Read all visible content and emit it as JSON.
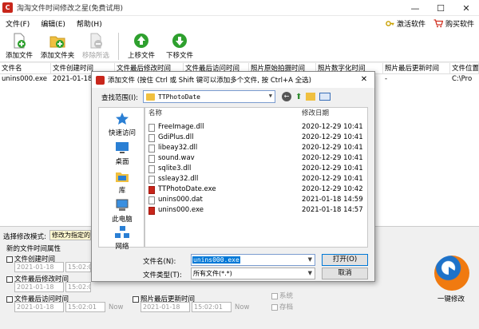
{
  "window": {
    "title": "淘淘文件时间修改之星(免费试用)",
    "minimize": "—",
    "maximize": "☐",
    "close": "✕"
  },
  "menu": {
    "items": [
      "文件(F)",
      "编辑(E)",
      "帮助(H)"
    ],
    "activate": "激活软件",
    "buy": "购买软件"
  },
  "toolbar": {
    "add_file": "添加文件",
    "add_folder": "添加文件夹",
    "remove": "移除所选",
    "move_up": "上移文件",
    "move_down": "下移文件"
  },
  "grid": {
    "headers": [
      "文件名",
      "文件创建时间",
      "文件最后修改时间",
      "文件最后访问时间",
      "照片原始拍摄时间",
      "照片数字化时间",
      "照片最后更新时间",
      "文件位置"
    ],
    "row": {
      "name": "unins000.exe",
      "created": "2021-01-18 1",
      "photo_updated": "-",
      "location": "C:\\Pro"
    }
  },
  "bottom": {
    "mode_label": "选择修改模式:",
    "mode_value": "修改为指定的新",
    "new_time_label": "新的文件时间属性",
    "create_label": "文件创建时间",
    "modify_label": "文件最后修改时间",
    "access_label": "文件最后访问时间",
    "photo_update_label": "照片最后更新时间",
    "date1": "2021-01-18",
    "time1": "15:02:01",
    "date2": "2021-01-18",
    "time2": "15:02:01",
    "date3": "2021-01-18",
    "time3": "15:02:01",
    "date4": "2021-01-18",
    "time4": "15:02:01",
    "now": "Now",
    "system_label": "系统",
    "archive_label": "存档",
    "one_click": "一键修改"
  },
  "dialog": {
    "title": "添加文件 (按住 Ctrl 或 Shift 键可以添加多个文件, 按 Ctrl+A 全选)",
    "close": "✕",
    "lookin_label": "查找范围(I):",
    "lookin_value": "TTPhotoDate",
    "places": [
      "快速访问",
      "桌面",
      "库",
      "此电脑",
      "网络"
    ],
    "col_name": "名称",
    "col_date": "修改日期",
    "files": [
      {
        "name": "FreeImage.dll",
        "date": "2020-12-29 10:41",
        "kind": "file"
      },
      {
        "name": "GdiPlus.dll",
        "date": "2020-12-29 10:41",
        "kind": "file"
      },
      {
        "name": "libeay32.dll",
        "date": "2020-12-29 10:41",
        "kind": "file"
      },
      {
        "name": "sound.wav",
        "date": "2020-12-29 10:41",
        "kind": "file"
      },
      {
        "name": "sqlite3.dll",
        "date": "2020-12-29 10:41",
        "kind": "file"
      },
      {
        "name": "ssleay32.dll",
        "date": "2020-12-29 10:41",
        "kind": "file"
      },
      {
        "name": "TTPhotoDate.exe",
        "date": "2020-12-29 10:42",
        "kind": "exe"
      },
      {
        "name": "unins000.dat",
        "date": "2021-01-18 14:59",
        "kind": "file"
      },
      {
        "name": "unins000.exe",
        "date": "2021-01-18 14:57",
        "kind": "exe"
      }
    ],
    "filename_label": "文件名(N):",
    "filename_value": "unins000.exe",
    "filetype_label": "文件类型(T):",
    "filetype_value": "所有文件(*.*)",
    "open_button": "打开(O)",
    "cancel_button": "取消"
  }
}
